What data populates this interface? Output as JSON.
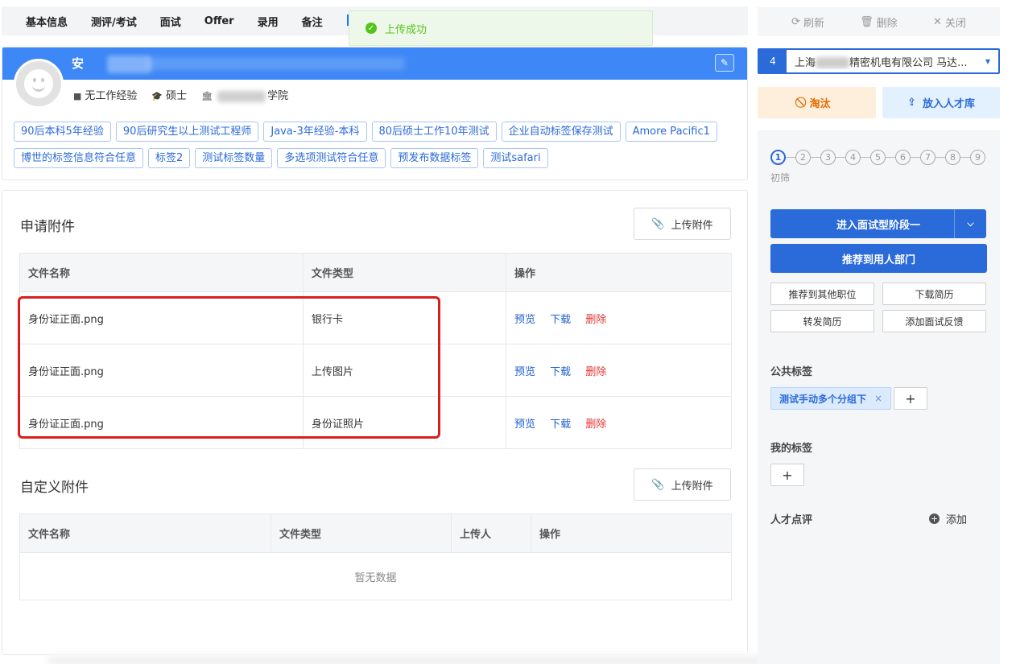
{
  "tabs": [
    "基本信息",
    "测评/考试",
    "面试",
    "Offer",
    "录用",
    "备注"
  ],
  "toast": {
    "message": "上传成功"
  },
  "profile": {
    "name": "安",
    "meta": {
      "experience": "无工作经验",
      "degree": "硕士",
      "school_suffix": "学院"
    },
    "tags": [
      "90后本科5年经验",
      "90后研究生以上测试工程师",
      "Java-3年经验-本科",
      "80后硕士工作10年测试",
      "企业自动标签保存测试",
      "Amore Pacific1",
      "博世的标签信息符合任意",
      "标签2",
      "测试标签数量",
      "多选项测试符合任意",
      "预发布数据标签",
      "测试safari"
    ]
  },
  "application_attachments": {
    "title": "申请附件",
    "upload_label": "上传附件",
    "columns": [
      "文件名称",
      "文件类型",
      "操作"
    ],
    "rows": [
      {
        "name": "身份证正面.png",
        "type": "银行卡"
      },
      {
        "name": "身份证正面.png",
        "type": "上传图片"
      },
      {
        "name": "身份证正面.png",
        "type": "身份证照片"
      }
    ],
    "actions": {
      "preview": "预览",
      "download": "下载",
      "delete": "删除"
    }
  },
  "custom_attachments": {
    "title": "自定义附件",
    "upload_label": "上传附件",
    "columns": [
      "文件名称",
      "文件类型",
      "上传人",
      "操作"
    ],
    "empty": "暂无数据"
  },
  "toolbar": {
    "refresh": "刷新",
    "delete": "删除",
    "close": "关闭"
  },
  "job": {
    "index": "4",
    "prefix": "上海",
    "suffix": "精密机电有限公司 马达..."
  },
  "actions": {
    "reject": "淘汰",
    "talent_pool": "放入人才库",
    "stage": "进入面试型阶段一",
    "recommend_dept": "推荐到用人部门",
    "recommend_other": "推荐到其他职位",
    "download_resume": "下载简历",
    "forward_resume": "转发简历",
    "add_feedback": "添加面试反馈"
  },
  "steps": {
    "items": [
      "1",
      "2",
      "3",
      "4",
      "5",
      "6",
      "7",
      "8",
      "9"
    ],
    "current_label": "初筛"
  },
  "public_tags": {
    "title": "公共标签",
    "items": [
      "测试手动多个分组下"
    ]
  },
  "my_tags": {
    "title": "我的标签"
  },
  "talent_review": {
    "title": "人才点评",
    "add_label": "添加"
  },
  "colors": {
    "primary": "#2a6ad9",
    "danger": "#e53535",
    "success": "#52c41a",
    "warning": "#e66a00"
  }
}
